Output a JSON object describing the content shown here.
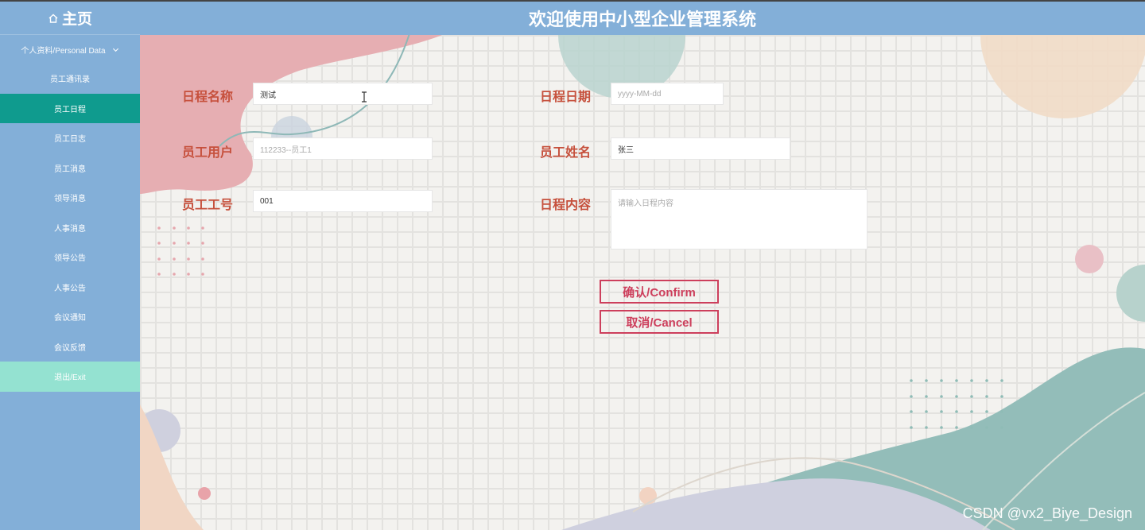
{
  "header": {
    "home_label": "主页",
    "title": "欢迎使用中小型企业管理系统"
  },
  "sidebar": {
    "group_label": "个人资料/Personal Data",
    "items": [
      {
        "label": "员工通讯录"
      },
      {
        "label": "员工日程"
      },
      {
        "label": "员工日志"
      },
      {
        "label": "员工消息"
      },
      {
        "label": "领导消息"
      },
      {
        "label": "人事消息"
      },
      {
        "label": "领导公告"
      },
      {
        "label": "人事公告"
      },
      {
        "label": "会议通知"
      },
      {
        "label": "会议反馈"
      },
      {
        "label": "退出/Exit"
      }
    ]
  },
  "form": {
    "schedule_name_label": "日程名称",
    "schedule_name_value": "测试",
    "schedule_date_label": "日程日期",
    "schedule_date_placeholder": "yyyy-MM-dd",
    "employee_user_label": "员工用户",
    "employee_user_value": "112233--员工1",
    "employee_name_label": "员工姓名",
    "employee_name_value": "张三",
    "employee_id_label": "员工工号",
    "employee_id_value": "001",
    "schedule_content_label": "日程内容",
    "schedule_content_placeholder": "请输入日程内容",
    "confirm_label": "确认/Confirm",
    "cancel_label": "取消/Cancel"
  },
  "watermark": "CSDN @vx2_Biye_Design",
  "colors": {
    "header_bg": "#83afd8",
    "active_item": "#0f9b8e",
    "exit_item": "#94e2d1",
    "label": "#c6503c",
    "button": "#cd3f5c"
  }
}
